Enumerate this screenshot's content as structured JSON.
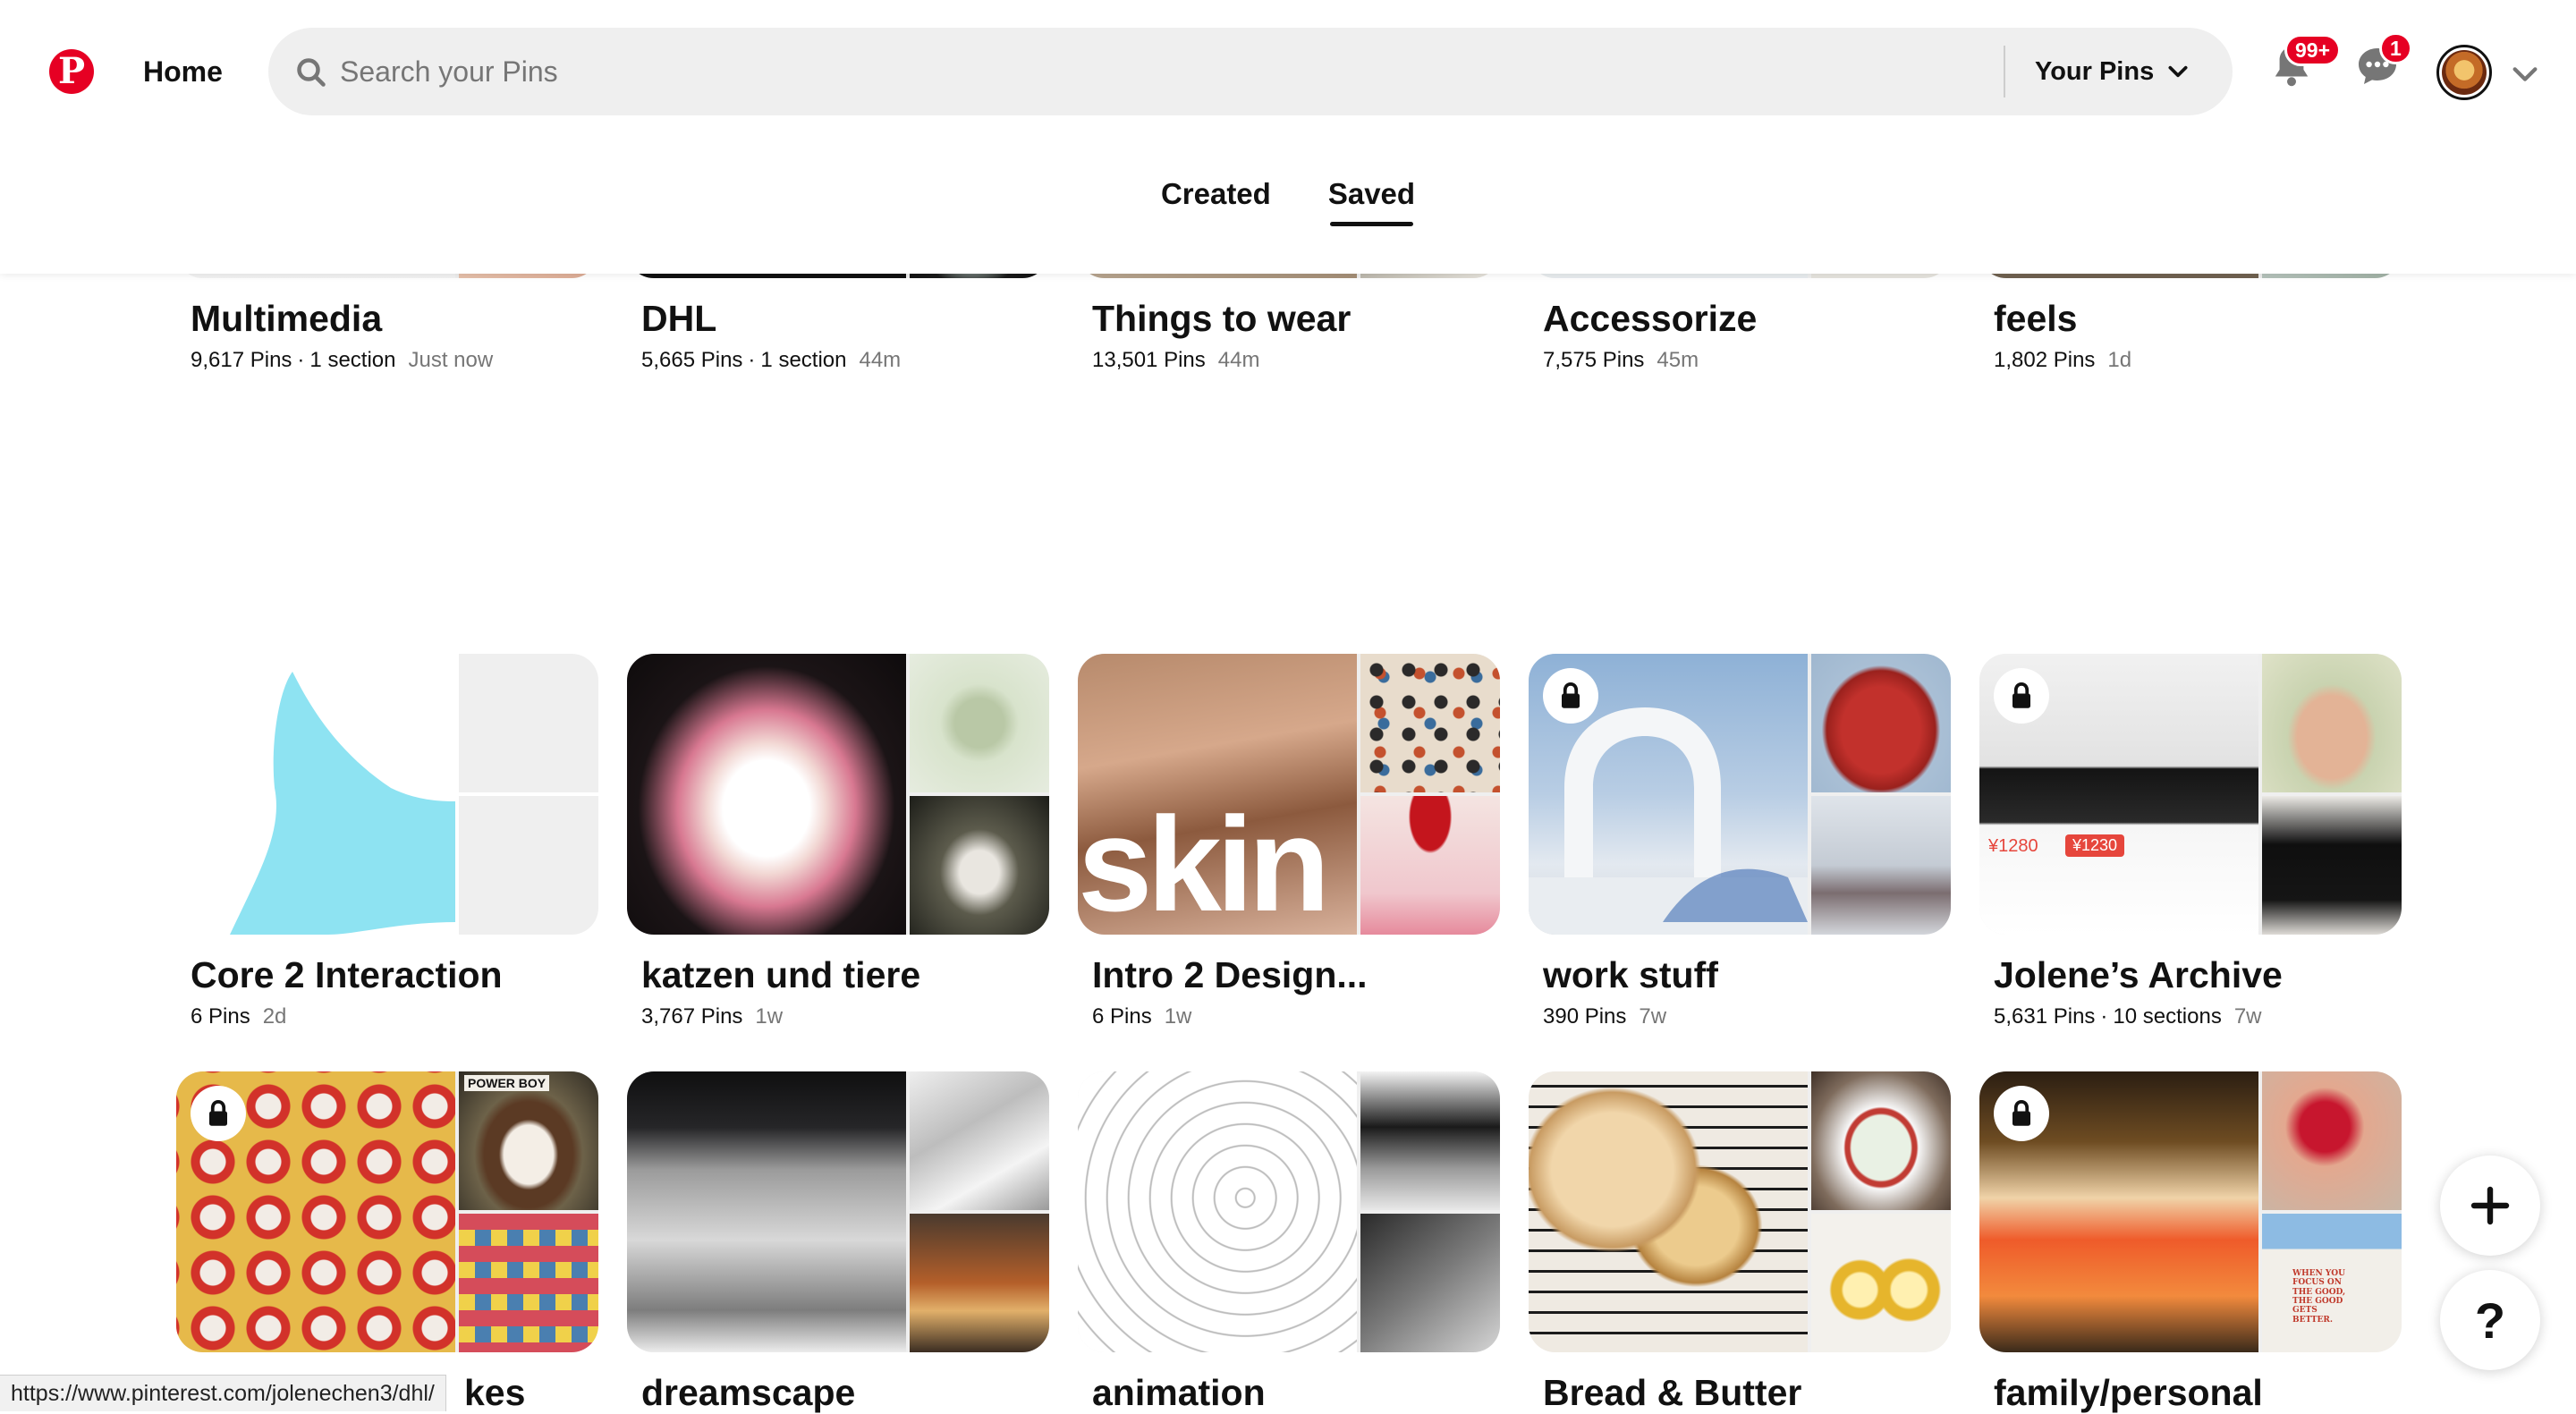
{
  "header": {
    "logo_letter": "P",
    "home_label": "Home",
    "search_placeholder": "Search your Pins",
    "filter_label": "Your Pins",
    "notifications_badge": "99+",
    "messages_badge": "1",
    "brand_color": "#e60023"
  },
  "tabs": [
    {
      "label": "Created",
      "active": false
    },
    {
      "label": "Saved",
      "active": true
    }
  ],
  "boards": [
    {
      "title": "Multimedia",
      "pins": "9,617 Pins",
      "sections": "1 section",
      "time": "Just now",
      "secret": true
    },
    {
      "title": "DHL",
      "pins": "5,665 Pins",
      "sections": "1 section",
      "time": "44m",
      "secret": false
    },
    {
      "title": "Things to wear",
      "pins": "13,501 Pins",
      "sections": "",
      "time": "44m",
      "secret": false
    },
    {
      "title": "Accessorize",
      "pins": "7,575 Pins",
      "sections": "",
      "time": "45m",
      "secret": false
    },
    {
      "title": "feels",
      "pins": "1,802 Pins",
      "sections": "",
      "time": "1d",
      "secret": true
    },
    {
      "title": "Core 2 Interaction",
      "pins": "6 Pins",
      "sections": "",
      "time": "2d",
      "secret": false
    },
    {
      "title": "katzen und tiere",
      "pins": "3,767 Pins",
      "sections": "",
      "time": "1w",
      "secret": false
    },
    {
      "title": "Intro 2 Design...",
      "pins": "6 Pins",
      "sections": "",
      "time": "1w",
      "secret": false
    },
    {
      "title": "work stuff",
      "pins": "390 Pins",
      "sections": "",
      "time": "7w",
      "secret": true
    },
    {
      "title": "Jolene’s Archive",
      "pins": "5,631 Pins",
      "sections": "10 sections",
      "time": "7w",
      "secret": true
    },
    {
      "title": "kes",
      "pins": "",
      "sections": "",
      "time": "",
      "secret": true
    },
    {
      "title": "dreamscape",
      "pins": "",
      "sections": "",
      "time": "",
      "secret": false
    },
    {
      "title": "animation",
      "pins": "",
      "sections": "",
      "time": "",
      "secret": false
    },
    {
      "title": "Bread & Butter",
      "pins": "",
      "sections": "",
      "time": "",
      "secret": false
    },
    {
      "title": "family/personal",
      "pins": "",
      "sections": "",
      "time": "",
      "secret": true
    }
  ],
  "overlay_text": {
    "skin_mag_word": "skin",
    "archive_price_1": "¥1280",
    "archive_price_2": "¥1230",
    "wall_text": "WHEN YOU FOCUS ON THE GOOD, THE GOOD GETS BETTER.",
    "dog_tag": "POWER BOY"
  },
  "fab": {
    "create_icon": "plus-icon",
    "help_label": "?"
  },
  "status_bar_url": "https://www.pinterest.com/jolenechen3/dhl/"
}
